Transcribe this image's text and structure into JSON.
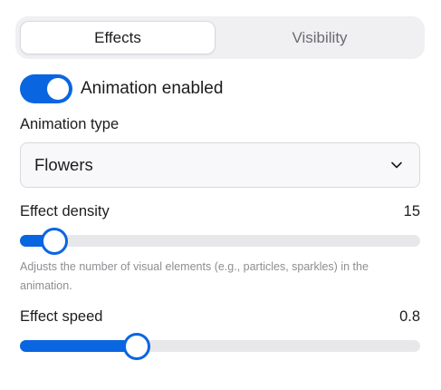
{
  "tabs": {
    "items": [
      {
        "label": "Effects",
        "active": true
      },
      {
        "label": "Visibility",
        "active": false
      }
    ]
  },
  "animation_toggle": {
    "label": "Animation enabled",
    "on": true
  },
  "animation_type": {
    "label": "Animation type",
    "selected": "Flowers",
    "icon": "chevron-down-icon"
  },
  "effect_density": {
    "label": "Effect density",
    "value": "15",
    "fill_fraction": 0.055,
    "help": "Adjusts the number of visual elements (e.g., particles, sparkles) in the animation."
  },
  "effect_speed": {
    "label": "Effect speed",
    "value": "0.8",
    "fill_fraction": 0.26
  },
  "colors": {
    "accent": "#0a66e0",
    "track": "#e8e8ea",
    "tab_bg": "#f0f0f2",
    "muted_text": "#8e8e93"
  }
}
